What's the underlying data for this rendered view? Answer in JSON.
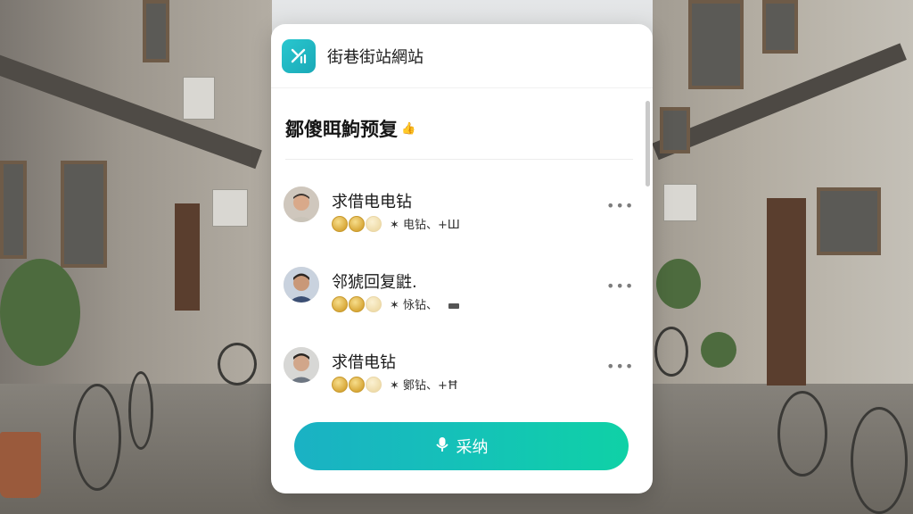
{
  "app": {
    "title": "街巷街站網站",
    "logo_icon": "signal-chart-icon"
  },
  "section": {
    "title": "鄒傻眲鮈预复",
    "title_icon": "thumbs-up-icon"
  },
  "replies": [
    {
      "name": "求借电电钻",
      "meta": "电钻、+Ш",
      "coins_full": 2,
      "coins_faded": 1,
      "more": "•••"
    },
    {
      "name": "邻猇回复鼪.",
      "meta": "怺钻、",
      "meta_icon": "tool-icon",
      "coins_full": 2,
      "coins_faded": 1,
      "more": "•••"
    },
    {
      "name": "求借电钻",
      "meta": "鄋钻、+Ħ",
      "coins_full": 2,
      "coins_faded": 1,
      "more": "•••"
    }
  ],
  "adopt_button": {
    "label": "采纳",
    "icon": "mic-icon"
  },
  "colors": {
    "accent_start": "#1ab1c4",
    "accent_end": "#0fd1a6",
    "coin": "#d9a93a"
  }
}
